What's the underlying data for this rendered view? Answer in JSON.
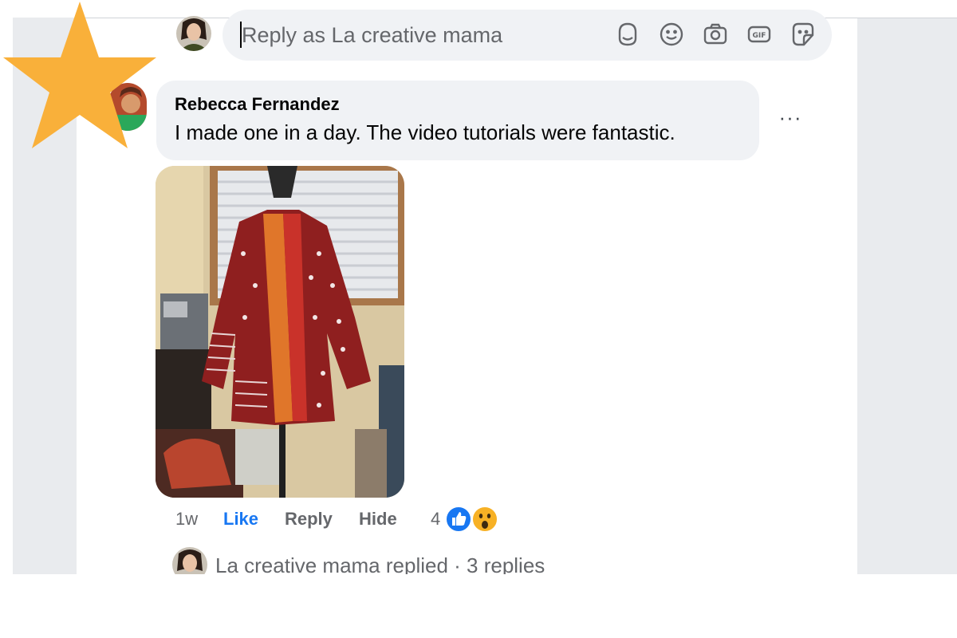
{
  "reply_box": {
    "placeholder": "Reply as La creative mama",
    "tools": [
      "avatar-sticker-icon",
      "emoji-icon",
      "camera-icon",
      "gif-icon",
      "sticker-icon"
    ]
  },
  "comment": {
    "author": "Rebecca Fernandez",
    "text": "I made one in a day. The video tutorials were fantastic.",
    "more_label": "···",
    "time": "1w",
    "like_label": "Like",
    "reply_label": "Reply",
    "hide_label": "Hide",
    "reaction_count": "4",
    "reactions": [
      "like-reaction-icon",
      "wow-reaction-icon"
    ]
  },
  "replies": {
    "summary": "La creative mama replied · 3 replies"
  },
  "colors": {
    "accent": "#1877f2",
    "bubble": "#f0f2f5",
    "star": "#f9b03a",
    "frame": "#e9ebee"
  }
}
